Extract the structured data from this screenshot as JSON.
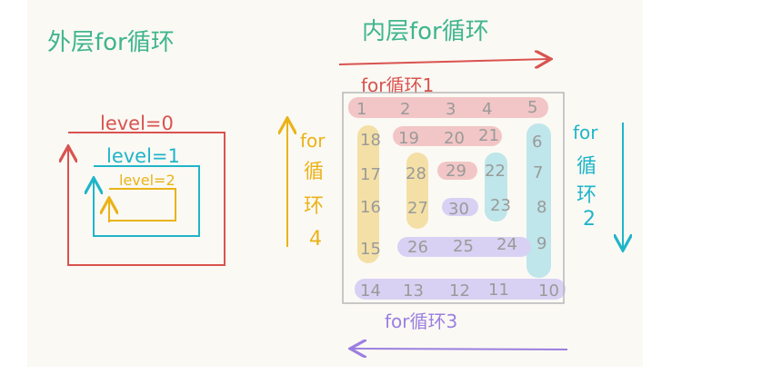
{
  "colors": {
    "paper": "#fbf9f4",
    "red": "#d9534f",
    "cyan": "#1fb5c9",
    "yellow": "#eab318",
    "purple": "#9b7fe0",
    "grid": "#b8b8b8",
    "number": "#9a9a9a",
    "green_label": "#3fb58e",
    "red_band": "#f2c6c6",
    "cyan_band": "#bfe6ea",
    "yellow_band": "#f4e0a6",
    "purple_band": "#d9d1f3"
  },
  "left": {
    "title": "外层for循环",
    "levels": [
      "level=0",
      "level=1",
      "level=2"
    ]
  },
  "right": {
    "title": "内层for循环",
    "loop1": "for循环1",
    "loop2": [
      "for",
      "循",
      "环",
      "2"
    ],
    "loop3": "for循环3",
    "loop4": [
      "for",
      "循",
      "环",
      "4"
    ],
    "numbers": [
      [
        "1",
        "2",
        "3",
        "4",
        "5"
      ],
      [
        "18",
        "19",
        "20",
        "21",
        "6"
      ],
      [
        "17",
        "28",
        "29",
        "22",
        "7"
      ],
      [
        "16",
        "27",
        "30",
        "23",
        "8"
      ],
      [
        "15",
        "26",
        "25",
        "24",
        "9"
      ],
      [
        "14",
        "13",
        "12",
        "11",
        "10"
      ]
    ]
  }
}
